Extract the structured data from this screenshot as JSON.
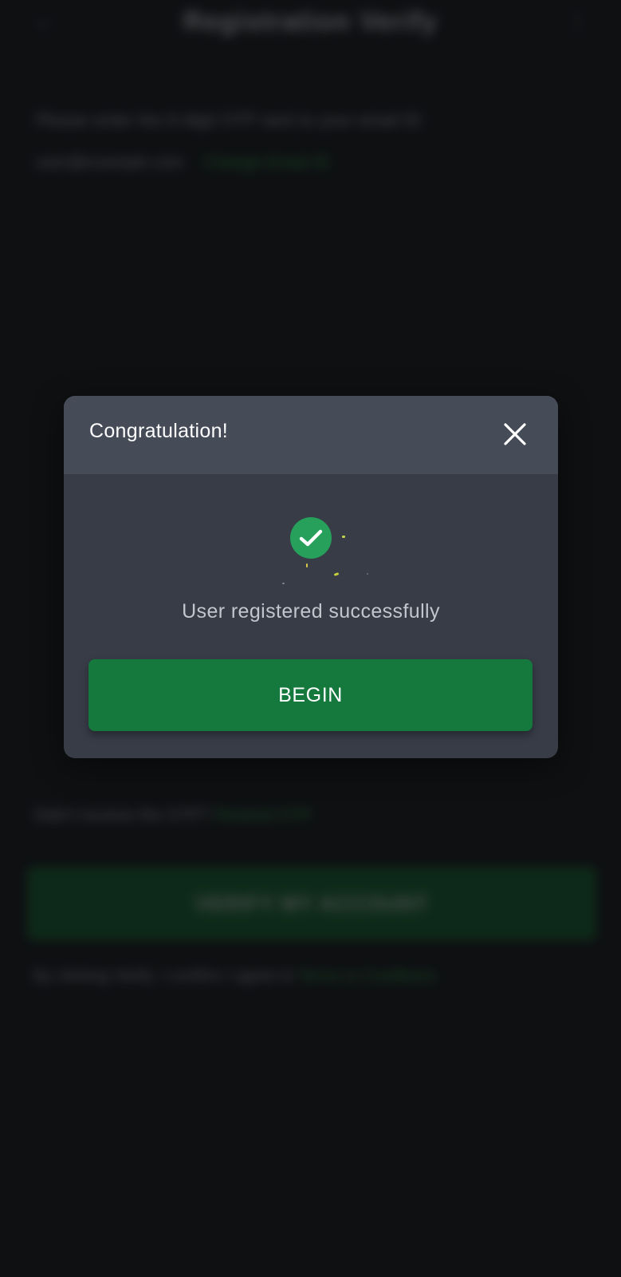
{
  "background": {
    "header": {
      "title": "Registration Verify",
      "back_icon": "back-arrow-icon",
      "menu_icon": "menu-icon"
    },
    "instructions": "Please enter the 6-digit OTP sent to your email ID",
    "email": {
      "value": "user@example.com",
      "change_link": "Change Email ID"
    },
    "resend": {
      "prompt": "Didn't receive the OTP?",
      "link": "Resend OTP"
    },
    "primary_button": "VERIFY MY ACCOUNT",
    "terms": {
      "prefix": "By clicking Verify, I confirm I agree to",
      "link": "Terms & Conditions"
    }
  },
  "dialog": {
    "title": "Congratulation!",
    "close_icon": "close-icon",
    "status_icon": "check-circle-icon",
    "message": "User registered successfully",
    "button_label": "BEGIN"
  },
  "colors": {
    "page_bg": "#121417",
    "dialog_bg": "#383c47",
    "dialog_header_bg": "#454c58",
    "success_green": "#27a05b",
    "button_green": "#15793d",
    "link_green": "#2bd05a"
  }
}
